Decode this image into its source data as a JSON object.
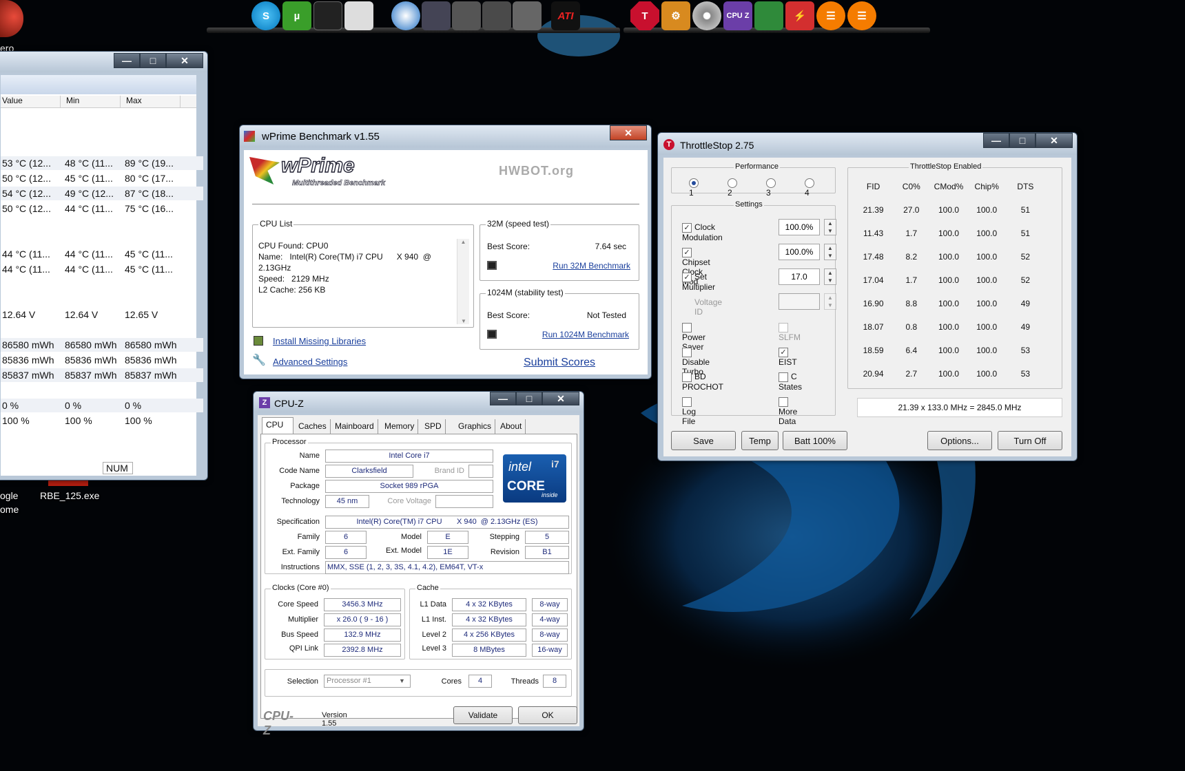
{
  "desktop": {
    "icon_labels": [
      "ero",
      "ogle",
      "ome",
      "RBE_125.exe"
    ]
  },
  "dock": {
    "left_icons": [
      "skype-icon",
      "utorrent-icon",
      "drive-icon",
      "removable-drive-icon",
      "teamviewer-icon",
      "game-icon-1",
      "game-icon-2",
      "game-icon-3",
      "crysis-icon",
      "ati-icon"
    ],
    "right_icons": [
      "throttlestop-icon",
      "settings-icon",
      "cd-icon",
      "cpuz-icon",
      "hardware-icon",
      "flash-icon",
      "menu-icon-1",
      "menu-icon-2"
    ],
    "ati_label": "ATI",
    "cpuz_label": "CPU Z"
  },
  "hwmonitor": {
    "columns": [
      "Value",
      "Min",
      "Max"
    ],
    "rows": [
      [
        "53 °C  (12...",
        "48 °C  (11...",
        "89 °C  (19..."
      ],
      [
        "50 °C  (12...",
        "45 °C  (11...",
        "80 °C  (17..."
      ],
      [
        "54 °C  (12...",
        "49 °C  (12...",
        "87 °C  (18..."
      ],
      [
        "50 °C  (12...",
        "44 °C  (11...",
        "75 °C  (16..."
      ],
      [
        "44 °C  (11...",
        "44 °C  (11...",
        "45 °C  (11..."
      ],
      [
        "44 °C  (11...",
        "44 °C  (11...",
        "45 °C  (11..."
      ],
      [
        "12.64 V",
        "12.64 V",
        "12.65 V"
      ],
      [
        "86580 mWh",
        "86580 mWh",
        "86580 mWh"
      ],
      [
        "85836 mWh",
        "85836 mWh",
        "85836 mWh"
      ],
      [
        "85837 mWh",
        "85837 mWh",
        "85837 mWh"
      ],
      [
        "0 %",
        "0 %",
        "0 %"
      ],
      [
        "100 %",
        "100 %",
        "100 %"
      ]
    ],
    "status_num": "NUM"
  },
  "wprime": {
    "title": "wPrime Benchmark v1.55",
    "logo": "wPrime",
    "logo_sub": "Multithreaded Benchmark",
    "hwbot": "HWBOT.org",
    "cpu_list_label": "CPU List",
    "cpu_lines": [
      "CPU Found: CPU0",
      "Name:   Intel(R) Core(TM) i7 CPU      X 940  @",
      "2.13GHz",
      "Speed:   2129 MHz",
      "L2 Cache: 256 KB"
    ],
    "speed_label": "32M (speed test)",
    "speed_best_label": "Best Score:",
    "speed_best": "7.64 sec",
    "speed_run": "Run 32M Benchmark",
    "stab_label": "1024M (stability test)",
    "stab_best_label": "Best Score:",
    "stab_best": "Not Tested",
    "stab_run": "Run 1024M Benchmark",
    "install_libs": "Install Missing Libraries",
    "advanced": "Advanced Settings",
    "submit": "Submit Scores"
  },
  "throttlestop": {
    "title": "ThrottleStop 2.75",
    "performance_label": "Performance",
    "profiles": [
      "1",
      "2",
      "3",
      "4"
    ],
    "settings_label": "Settings",
    "clock_modulation": "Clock Modulation",
    "clock_modulation_val": "100.0%",
    "chipset_clock_mod": "Chipset Clock Mod",
    "chipset_clock_mod_val": "100.0%",
    "set_multiplier": "Set Multiplier",
    "set_multiplier_val": "17.0",
    "voltage_id": "Voltage ID",
    "power_saver": "Power Saver",
    "slfm": "SLFM",
    "disable_turbo": "Disable Turbo",
    "eist": "EIST",
    "bd_prochot": "BD PROCHOT",
    "c_states": "C States",
    "log_file": "Log File",
    "more_data": "More Data",
    "enabled_label": "ThrottleStop Enabled",
    "columns": [
      "FID",
      "C0%",
      "CMod%",
      "Chip%",
      "DTS"
    ],
    "rows": [
      [
        "21.39",
        "27.0",
        "100.0",
        "100.0",
        "51"
      ],
      [
        "11.43",
        "1.7",
        "100.0",
        "100.0",
        "51"
      ],
      [
        "17.48",
        "8.2",
        "100.0",
        "100.0",
        "52"
      ],
      [
        "17.04",
        "1.7",
        "100.0",
        "100.0",
        "52"
      ],
      [
        "16.90",
        "8.8",
        "100.0",
        "100.0",
        "49"
      ],
      [
        "18.07",
        "0.8",
        "100.0",
        "100.0",
        "49"
      ],
      [
        "18.59",
        "6.4",
        "100.0",
        "100.0",
        "53"
      ],
      [
        "20.94",
        "2.7",
        "100.0",
        "100.0",
        "53"
      ]
    ],
    "summary": "21.39 x 133.0 MHz = 2845.0 MHz",
    "save": "Save",
    "temp": "Temp",
    "batt": "Batt 100%",
    "options": "Options...",
    "turn_off": "Turn Off"
  },
  "cpuz": {
    "title": "CPU-Z",
    "tabs": [
      "CPU",
      "Caches",
      "Mainboard",
      "Memory",
      "SPD",
      "Graphics",
      "About"
    ],
    "processor_label": "Processor",
    "name_label": "Name",
    "name": "Intel Core i7",
    "codename_label": "Code Name",
    "codename": "Clarksfield",
    "brandid_label": "Brand ID",
    "package_label": "Package",
    "package": "Socket 989 rPGA",
    "technology_label": "Technology",
    "technology": "45 nm",
    "corevoltage_label": "Core Voltage",
    "spec_label": "Specification",
    "spec": "Intel(R) Core(TM) i7 CPU       X 940  @ 2.13GHz (ES)",
    "family_label": "Family",
    "family": "6",
    "model_label": "Model",
    "model": "E",
    "stepping_label": "Stepping",
    "stepping": "5",
    "extfamily_label": "Ext. Family",
    "extfamily": "6",
    "extmodel_label": "Ext. Model",
    "extmodel": "1E",
    "revision_label": "Revision",
    "revision": "B1",
    "instr_label": "Instructions",
    "instr": "MMX, SSE (1, 2, 3, 3S, 4.1, 4.2), EM64T, VT-x",
    "clocks_label": "Clocks (Core #0)",
    "corespeed_label": "Core Speed",
    "corespeed": "3456.3 MHz",
    "multiplier_label": "Multiplier",
    "multiplier": "x 26.0 ( 9 - 16 )",
    "busspeed_label": "Bus Speed",
    "busspeed": "132.9 MHz",
    "qpilink_label": "QPI Link",
    "qpilink": "2392.8 MHz",
    "cache_label": "Cache",
    "l1d_label": "L1 Data",
    "l1d": "4 x 32 KBytes",
    "l1d_way": "8-way",
    "l1i_label": "L1 Inst.",
    "l1i": "4 x 32 KBytes",
    "l1i_way": "4-way",
    "l2_label": "Level 2",
    "l2": "4 x 256 KBytes",
    "l2_way": "8-way",
    "l3_label": "Level 3",
    "l3": "8 MBytes",
    "l3_way": "16-way",
    "selection_label": "Selection",
    "selection": "Processor #1",
    "cores_label": "Cores",
    "cores": "4",
    "threads_label": "Threads",
    "threads": "8",
    "brand": "CPU-Z",
    "version": "Version 1.55",
    "validate": "Validate",
    "ok": "OK",
    "intel_logo": "intel",
    "intel_core": "CORE",
    "intel_i7": "i7",
    "intel_inside": "inside"
  },
  "colors": {
    "accent": "#1a3f9c",
    "field_text": "#1d2a7a",
    "close_red": "#c24225"
  }
}
